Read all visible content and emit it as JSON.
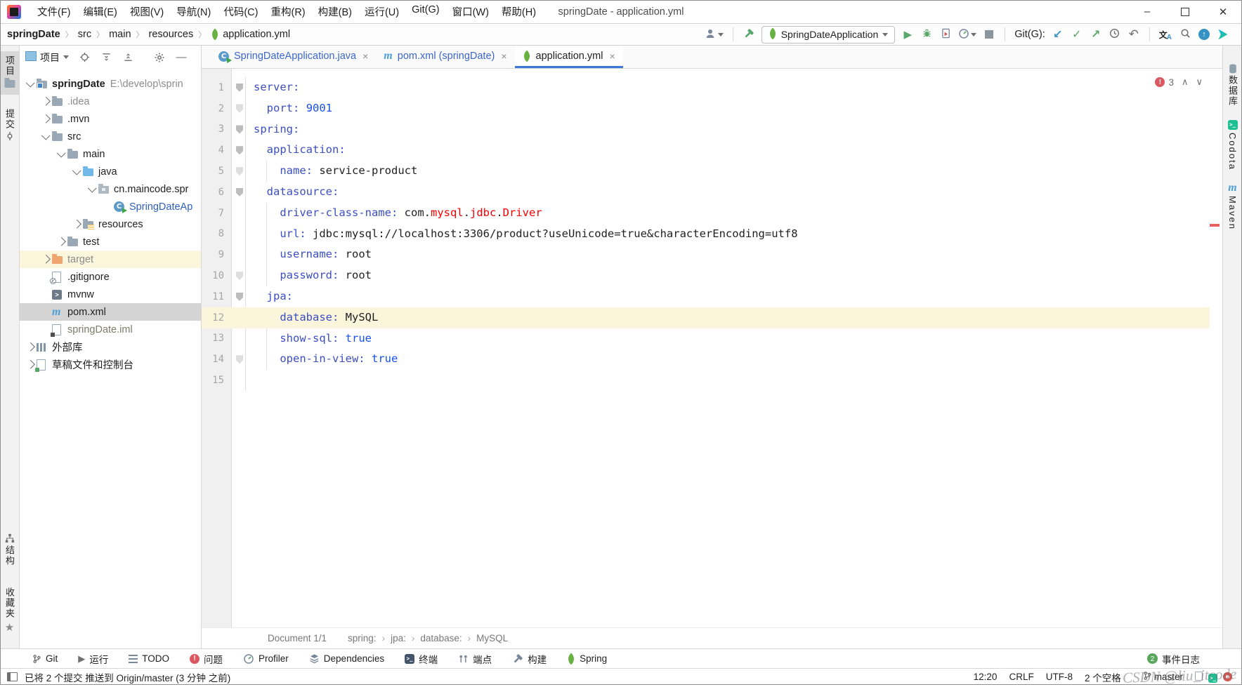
{
  "window": {
    "title": "springDate - application.yml",
    "controls": [
      "minimize",
      "maximize",
      "close"
    ]
  },
  "menu_bar": {
    "items": [
      "文件(F)",
      "编辑(E)",
      "视图(V)",
      "导航(N)",
      "代码(C)",
      "重构(R)",
      "构建(B)",
      "运行(U)",
      "Git(G)",
      "窗口(W)",
      "帮助(H)"
    ]
  },
  "nav_bar": {
    "breadcrumbs": [
      {
        "label": "springDate",
        "bold": true
      },
      {
        "label": "src"
      },
      {
        "label": "main"
      },
      {
        "label": "resources"
      },
      {
        "label": "application.yml",
        "icon": "spring-leaf"
      }
    ],
    "run_config": {
      "label": "SpringDateApplication",
      "icon": "spring-leaf"
    },
    "git_label": "Git(G):"
  },
  "tool_stripes": {
    "left_top": [
      {
        "label": "项目",
        "icon": "tool-window",
        "active": true
      },
      {
        "label": "提交",
        "icon": "commit"
      }
    ],
    "left_bottom": [
      {
        "label": "结构",
        "icon": "structure"
      },
      {
        "label": "收藏夹",
        "icon": "star"
      }
    ],
    "right": [
      {
        "label": "数据库",
        "icon": "database"
      },
      {
        "label": "Codota",
        "icon": "codota"
      },
      {
        "label": "Maven",
        "icon": "maven"
      }
    ]
  },
  "project_panel": {
    "title": "项目",
    "tree": [
      {
        "depth": 0,
        "chevron": "down",
        "icon": "folder-project",
        "label": "springDate",
        "bold": true,
        "extra": "E:\\develop\\sprin"
      },
      {
        "depth": 1,
        "chevron": "right",
        "icon": "folder",
        "label": ".idea",
        "color": "gray"
      },
      {
        "depth": 1,
        "chevron": "right",
        "icon": "folder",
        "label": ".mvn"
      },
      {
        "depth": 1,
        "chevron": "down",
        "icon": "folder",
        "label": "src"
      },
      {
        "depth": 2,
        "chevron": "down",
        "icon": "folder",
        "label": "main"
      },
      {
        "depth": 3,
        "chevron": "down",
        "icon": "folder-blue",
        "label": "java"
      },
      {
        "depth": 4,
        "chevron": "down",
        "icon": "folder-package",
        "label": "cn.maincode.spr"
      },
      {
        "depth": 5,
        "chevron": "none",
        "icon": "class-run",
        "label": "SpringDateAp",
        "color": "blue"
      },
      {
        "depth": 3,
        "chevron": "right",
        "icon": "folder-resources",
        "label": "resources"
      },
      {
        "depth": 2,
        "chevron": "right",
        "icon": "folder",
        "label": "test"
      },
      {
        "depth": 1,
        "chevron": "right",
        "icon": "folder-orange",
        "label": "target",
        "color": "gray",
        "row": "highlight"
      },
      {
        "depth": 1,
        "chevron": "none",
        "icon": "file-ignored",
        "label": ".gitignore"
      },
      {
        "depth": 1,
        "chevron": "none",
        "icon": "file-mvnw",
        "label": "mvnw"
      },
      {
        "depth": 1,
        "chevron": "none",
        "icon": "maven",
        "label": "pom.xml",
        "row": "selected"
      },
      {
        "depth": 1,
        "chevron": "none",
        "icon": "file-iml",
        "label": "springDate.iml",
        "color": "olive"
      },
      {
        "depth": 0,
        "chevron": "right",
        "icon": "library",
        "label": "外部库"
      },
      {
        "depth": 0,
        "chevron": "right",
        "icon": "scratch",
        "label": "草稿文件和控制台"
      }
    ]
  },
  "editor": {
    "tabs": [
      {
        "label": "SpringDateApplication.java",
        "icon": "class-run",
        "color": "blue"
      },
      {
        "label": "pom.xml (springDate)",
        "icon": "maven",
        "color": "blue"
      },
      {
        "label": "application.yml",
        "icon": "spring-leaf",
        "active": true
      }
    ],
    "inspection": {
      "errors": "3"
    },
    "lines": [
      {
        "n": "1",
        "fold": "open",
        "seg": [
          [
            "server:",
            "k"
          ]
        ]
      },
      {
        "n": "2",
        "fold": "closed",
        "seg": [
          [
            "  ",
            ""
          ],
          [
            "port:",
            "k"
          ],
          [
            " ",
            ""
          ],
          [
            "9001",
            "v"
          ]
        ]
      },
      {
        "n": "3",
        "fold": "open",
        "seg": [
          [
            "spring:",
            "k"
          ]
        ]
      },
      {
        "n": "4",
        "fold": "open",
        "seg": [
          [
            "  ",
            ""
          ],
          [
            "application:",
            "k"
          ]
        ]
      },
      {
        "n": "5",
        "fold": "closed",
        "seg": [
          [
            "    ",
            ""
          ],
          [
            "name:",
            "k"
          ],
          [
            " ",
            ""
          ],
          [
            "service-product",
            ""
          ]
        ]
      },
      {
        "n": "6",
        "fold": "open",
        "seg": [
          [
            "  ",
            ""
          ],
          [
            "datasource:",
            "k"
          ]
        ]
      },
      {
        "n": "7",
        "fold": "none",
        "seg": [
          [
            "    ",
            ""
          ],
          [
            "driver-class-name:",
            "k"
          ],
          [
            " ",
            ""
          ],
          [
            "com.",
            ""
          ],
          [
            "mysql",
            "e"
          ],
          [
            ".",
            ""
          ],
          [
            "jdbc",
            "e"
          ],
          [
            ".",
            ""
          ],
          [
            "Driver",
            "e"
          ]
        ]
      },
      {
        "n": "8",
        "fold": "none",
        "seg": [
          [
            "    ",
            ""
          ],
          [
            "url:",
            "k"
          ],
          [
            " ",
            ""
          ],
          [
            "jdbc:mysql://localhost:3306/product?useUnicode=true&characterEncoding=utf8",
            ""
          ]
        ]
      },
      {
        "n": "9",
        "fold": "none",
        "seg": [
          [
            "    ",
            ""
          ],
          [
            "username:",
            "k"
          ],
          [
            " ",
            ""
          ],
          [
            "root",
            ""
          ]
        ]
      },
      {
        "n": "10",
        "fold": "closed",
        "seg": [
          [
            "    ",
            ""
          ],
          [
            "password:",
            "k"
          ],
          [
            " ",
            ""
          ],
          [
            "root",
            ""
          ]
        ]
      },
      {
        "n": "11",
        "fold": "open",
        "seg": [
          [
            "  ",
            ""
          ],
          [
            "jpa:",
            "k"
          ]
        ]
      },
      {
        "n": "12",
        "fold": "none",
        "current": true,
        "seg": [
          [
            "    ",
            ""
          ],
          [
            "database:",
            "k"
          ],
          [
            " ",
            ""
          ],
          [
            "MySQL",
            ""
          ]
        ]
      },
      {
        "n": "13",
        "fold": "none",
        "seg": [
          [
            "    ",
            ""
          ],
          [
            "show-sql:",
            "k"
          ],
          [
            " ",
            ""
          ],
          [
            "true",
            "v"
          ]
        ]
      },
      {
        "n": "14",
        "fold": "closed",
        "seg": [
          [
            "    ",
            ""
          ],
          [
            "open-in-view:",
            "k"
          ],
          [
            " ",
            ""
          ],
          [
            "true",
            "v"
          ]
        ]
      },
      {
        "n": "15",
        "fold": "none",
        "seg": []
      }
    ],
    "breadcrumbs": [
      "Document 1/1",
      "spring:",
      "jpa:",
      "database:",
      "MySQL"
    ]
  },
  "bottom_bar": {
    "items": [
      {
        "label": "Git",
        "icon": "branch"
      },
      {
        "label": "运行",
        "icon": "play-gray"
      },
      {
        "label": "TODO",
        "icon": "todo"
      },
      {
        "label": "问题",
        "icon": "problem"
      },
      {
        "label": "Profiler",
        "icon": "profiler"
      },
      {
        "label": "Dependencies",
        "icon": "layers"
      },
      {
        "label": "终端",
        "icon": "terminal"
      },
      {
        "label": "端点",
        "icon": "endpoints"
      },
      {
        "label": "构建",
        "icon": "hammer-gray"
      },
      {
        "label": "Spring",
        "icon": "spring-leaf"
      }
    ],
    "event_log": {
      "badge": "2",
      "label": "事件日志"
    }
  },
  "status_bar": {
    "message": "已将 2 个提交 推送到 Origin/master (3 分钟 之前)",
    "time": "12:20",
    "line_sep": "CRLF",
    "encoding": "UTF-8",
    "indent": "2 个空格",
    "branch": "master"
  },
  "watermark": "CSDN @liu_itcode"
}
